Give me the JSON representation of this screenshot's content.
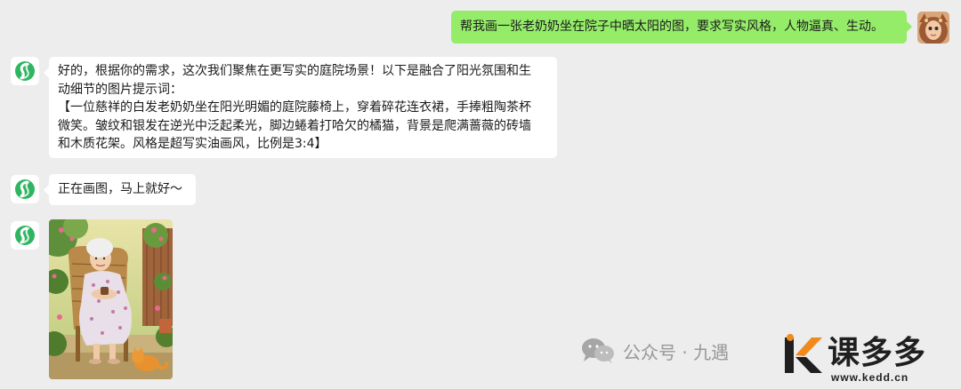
{
  "messages": {
    "user_prompt": "帮我画一张老奶奶坐在院子中晒太阳的图，要求写实风格，人物逼真、生动。",
    "bot_reply_lines": [
      "好的，根据你的需求，这次我们聚焦在更写实的庭院场景！以下是融合了阳光氛围和生",
      "动细节的图片提示词：",
      "【一位慈祥的白发老奶奶坐在阳光明媚的庭院藤椅上，穿着碎花连衣裙，手捧粗陶茶杯",
      "微笑。皱纹和银发在逆光中泛起柔光，脚边蜷着打哈欠的橘猫，背景是爬满蔷薇的砖墙",
      "和木质花架。风格是超写实油画风，比例是3:4】"
    ],
    "bot_status": "正在画图，马上就好～"
  },
  "watermark": {
    "text": "公众号 · 九遇",
    "brand": "课多多",
    "url": "www.kedd.cn"
  },
  "colors": {
    "background": "#ededed",
    "user_bubble": "#95ec69",
    "bot_bubble": "#ffffff",
    "bot_icon": "#2fb562",
    "brand_orange": "#f08a1c"
  },
  "icons": {
    "bot_avatar": "green-swirl-icon",
    "user_avatar": "girl-portrait",
    "watermark": "wechat-icon"
  }
}
